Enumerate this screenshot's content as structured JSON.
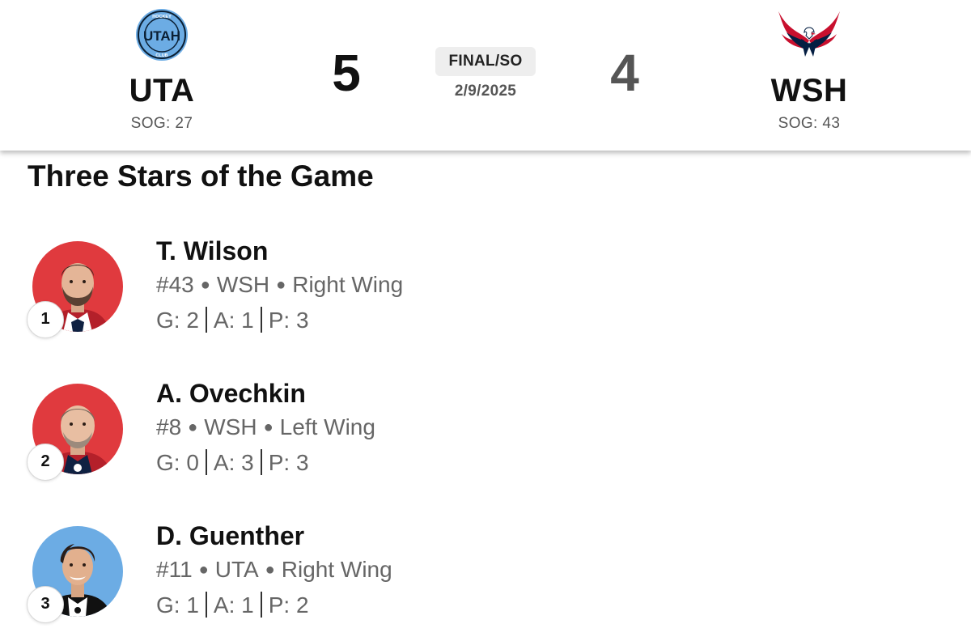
{
  "scoreboard": {
    "home": {
      "abbr": "UTA",
      "sog": "SOG: 27",
      "score": "5",
      "logo_icon": "utah-hockey-club-logo",
      "logo_text": "UTAH",
      "logo_ring_top": "HOCKEY",
      "logo_ring_bottom": "CLUB",
      "logo_color": "#6CACE4"
    },
    "away": {
      "abbr": "WSH",
      "sog": "SOG: 43",
      "score": "4",
      "logo_icon": "washington-capitals-eagle-logo",
      "logo_colors": [
        "#C8102E",
        "#041E42"
      ]
    },
    "status": "FINAL/SO",
    "date": "2/9/2025"
  },
  "three_stars": {
    "title": "Three Stars of the Game",
    "players": [
      {
        "rank": "1",
        "name": "T. Wilson",
        "number": "#43",
        "team": "WSH",
        "position": "Right Wing",
        "stats": [
          "G: 2",
          "A: 1",
          "P: 3"
        ],
        "avatar_bg": "#E03A3E"
      },
      {
        "rank": "2",
        "name": "A. Ovechkin",
        "number": "#8",
        "team": "WSH",
        "position": "Left Wing",
        "stats": [
          "G: 0",
          "A: 3",
          "P: 3"
        ],
        "avatar_bg": "#E03A3E"
      },
      {
        "rank": "3",
        "name": "D. Guenther",
        "number": "#11",
        "team": "UTA",
        "position": "Right Wing",
        "stats": [
          "G: 1",
          "A: 1",
          "P: 2"
        ],
        "avatar_bg": "#6CACE4"
      }
    ]
  }
}
